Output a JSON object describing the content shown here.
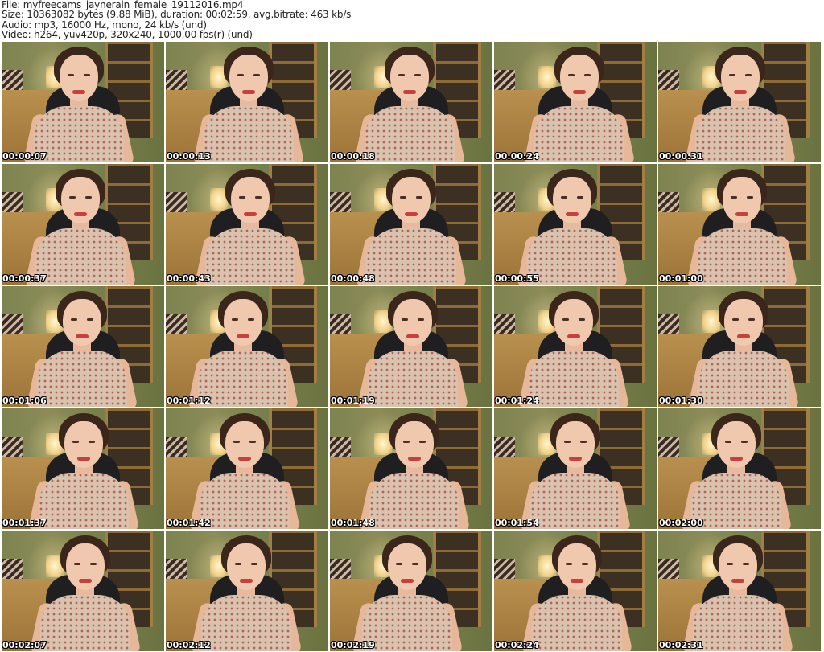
{
  "header": {
    "file_line": "File: myfreecams_jaynerain_female_19112016.mp4",
    "size_line": "Size: 10363082 bytes (9.88 MiB), duration: 00:02:59, avg.bitrate: 463 kb/s",
    "audio_line": "Audio: mp3, 16000 Hz, mono, 24 kb/s (und)",
    "video_line": "Video: h264, yuv420p, 320x240, 1000.00 fps(r) (und)"
  },
  "thumbnails": [
    {
      "timestamp": "00:00:07"
    },
    {
      "timestamp": "00:00:13"
    },
    {
      "timestamp": "00:00:18"
    },
    {
      "timestamp": "00:00:24"
    },
    {
      "timestamp": "00:00:31"
    },
    {
      "timestamp": "00:00:37"
    },
    {
      "timestamp": "00:00:43"
    },
    {
      "timestamp": "00:00:48"
    },
    {
      "timestamp": "00:00:55"
    },
    {
      "timestamp": "00:01:00"
    },
    {
      "timestamp": "00:01:06"
    },
    {
      "timestamp": "00:01:12"
    },
    {
      "timestamp": "00:01:19"
    },
    {
      "timestamp": "00:01:24"
    },
    {
      "timestamp": "00:01:30"
    },
    {
      "timestamp": "00:01:37"
    },
    {
      "timestamp": "00:01:42"
    },
    {
      "timestamp": "00:01:48"
    },
    {
      "timestamp": "00:01:54"
    },
    {
      "timestamp": "00:02:00"
    },
    {
      "timestamp": "00:02:07"
    },
    {
      "timestamp": "00:02:12"
    },
    {
      "timestamp": "00:02:19"
    },
    {
      "timestamp": "00:02:24"
    },
    {
      "timestamp": "00:02:31"
    }
  ]
}
